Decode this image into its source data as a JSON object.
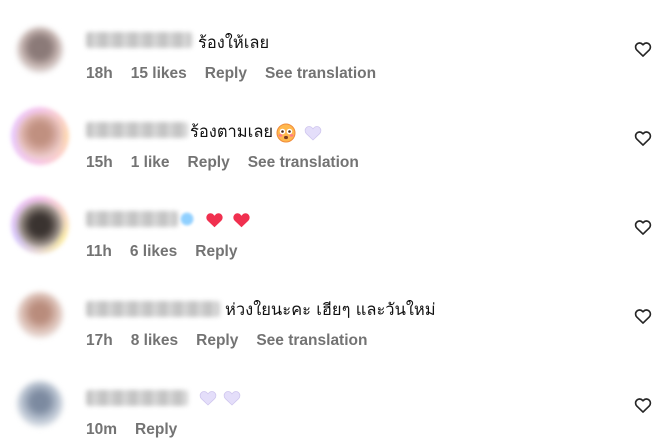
{
  "comments": [
    {
      "text": "ร้องให้เลย",
      "time": "18h",
      "likes": "15 likes",
      "reply": "Reply",
      "translate": "See translation"
    },
    {
      "text": "ร้องตามเลย",
      "time": "15h",
      "likes": "1 like",
      "reply": "Reply",
      "translate": "See translation"
    },
    {
      "text": "",
      "time": "11h",
      "likes": "6 likes",
      "reply": "Reply"
    },
    {
      "text": "ห่วงใยนะคะ เฮียๆ และวันใหม่",
      "time": "17h",
      "likes": "8 likes",
      "reply": "Reply",
      "translate": "See translation"
    },
    {
      "text": "",
      "time": "10m",
      "reply": "Reply"
    }
  ],
  "colors": {
    "meta": "#737373",
    "heart_red": "#f0304f",
    "heart_white": "#e4defa",
    "icon": "#262626"
  },
  "icons": {
    "like": "heart-outline-icon",
    "emoji_red": "red-heart-emoji",
    "emoji_white": "white-heart-emoji",
    "emoji_flushed": "flushed-face-emoji"
  }
}
